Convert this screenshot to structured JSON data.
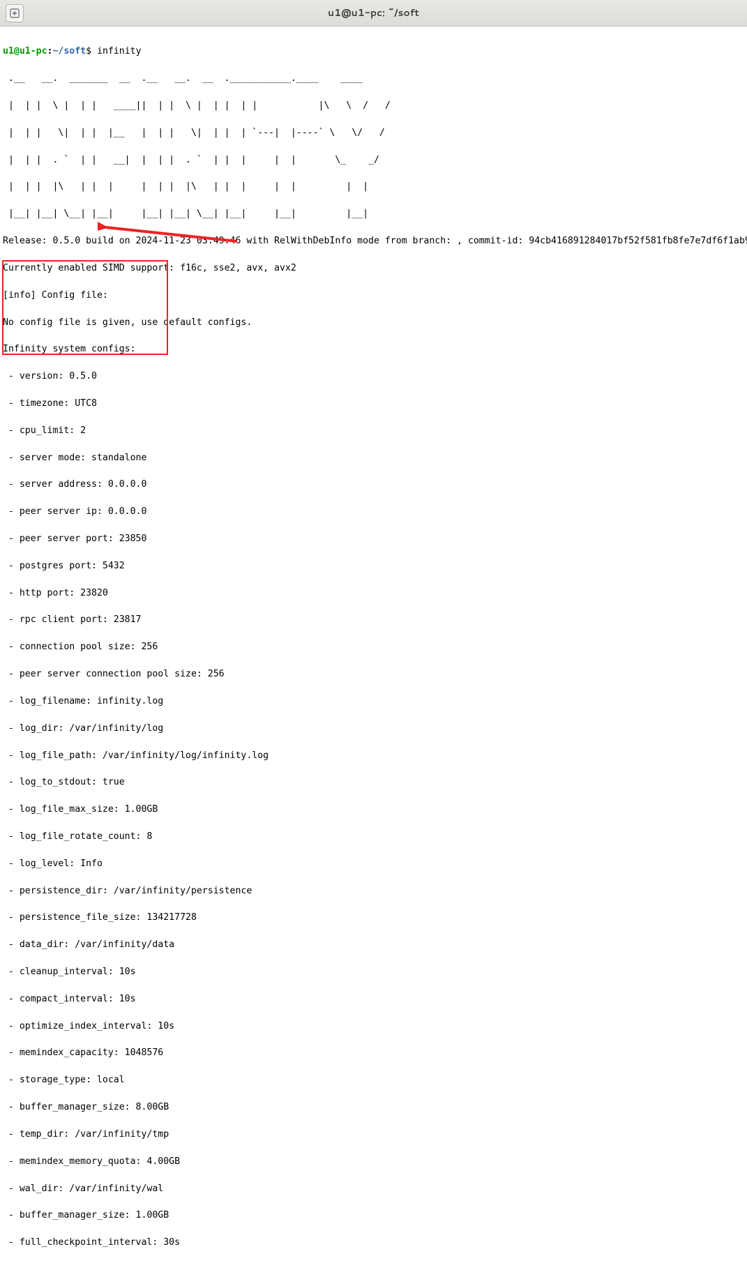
{
  "titlebar": {
    "title": "u1@u1-pc: ~/soft",
    "new_tab_icon": "⊞"
  },
  "prompt": {
    "user": "u1@u1-pc",
    "colon": ":",
    "path": "~/soft",
    "dollar": "$",
    "command": "infinity"
  },
  "ascii_art": [
    " .__   __.  _______  __  .__   __.  __  .___________.____    ____",
    " |  | |  \\ |  | |   ____||  | |  \\ |  | |  | |           |\\   \\  /   /",
    " |  | |   \\|  | |  |__   |  | |   \\|  | |  | `---|  |----` \\   \\/   /",
    " |  | |  . `  | |   __|  |  | |  . `  | |  |     |  |       \\_    _/",
    " |  | |  |\\   | |  |     |  | |  |\\   | |  |     |  |         |  |",
    " |__| |__| \\__| |__|     |__| |__| \\__| |__|     |__|         |__|"
  ],
  "release_line": "Release: 0.5.0 build on 2024-11-23 03:49.46 with RelWithDebInfo mode from branch: , commit-id: 94cb416891284017bf52f581fb8fe7e7df6f1ab9",
  "simd_line": "Currently enabled SIMD support: f16c, sse2, avx, avx2",
  "info_config": "[info] Config file:",
  "no_config": "No config file is given, use default configs.",
  "sys_configs_header": "Infinity system configs:",
  "configs": [
    " - version: 0.5.0",
    " - timezone: UTC8",
    " - cpu_limit: 2",
    " - server mode: standalone",
    " - server address: 0.0.0.0",
    " - peer server ip: 0.0.0.0",
    " - peer server port: 23850",
    " - postgres port: 5432",
    " - http port: 23820",
    " - rpc client port: 23817",
    " - connection pool size: 256",
    " - peer server connection pool size: 256",
    " - log_filename: infinity.log",
    " - log_dir: /var/infinity/log",
    " - log_file_path: /var/infinity/log/infinity.log",
    " - log_to_stdout: true",
    " - log_file_max_size: 1.00GB",
    " - log_file_rotate_count: 8",
    " - log_level: Info",
    " - persistence_dir: /var/infinity/persistence",
    " - persistence_file_size: 134217728",
    " - data_dir: /var/infinity/data",
    " - cleanup_interval: 10s",
    " - compact_interval: 10s",
    " - optimize_index_interval: 10s",
    " - memindex_capacity: 1048576",
    " - storage_type: local",
    " - buffer_manager_size: 8.00GB",
    " - temp_dir: /var/infinity/tmp",
    " - memindex_memory_quota: 4.00GB",
    " - wal_dir: /var/infinity/wal",
    " - buffer_manager_size: 1.00GB",
    " - full_checkpoint_interval: 30s"
  ]
}
